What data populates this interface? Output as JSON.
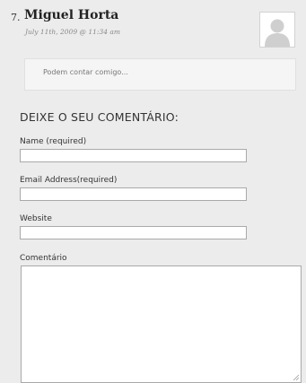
{
  "comment": {
    "number": "7.",
    "author": "Miguel Horta",
    "date": "July 11th, 2009 @ 11:34 am",
    "text": "Podem contar comigo..."
  },
  "form": {
    "heading": "DEIXE O SEU COMENTÁRIO:",
    "name_label": "Name (required)",
    "name_value": "",
    "email_label": "Email Address(required)",
    "email_value": "",
    "website_label": "Website",
    "website_value": "",
    "comment_label": "Comentário",
    "comment_value": ""
  },
  "icons": {
    "avatar": "default-avatar-icon",
    "resize": "resize-grip-icon"
  },
  "colors": {
    "background": "#ececec",
    "comment_box": "#f5f5f5",
    "input_border": "#a9a9a9"
  }
}
